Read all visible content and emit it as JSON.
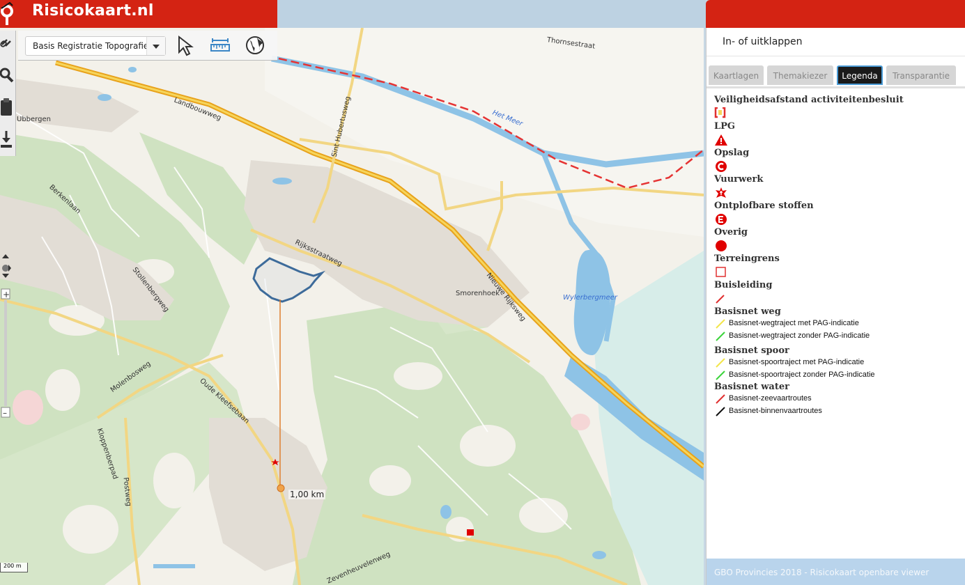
{
  "header": {
    "title": "Risicokaart.nl"
  },
  "toolbar": {
    "layer_select": {
      "value": "Basis Registratie Topografie"
    },
    "tools": [
      {
        "icon": "select-arrow-icon"
      },
      {
        "icon": "measure-ruler-icon"
      },
      {
        "icon": "globe-icon"
      }
    ]
  },
  "left_tools": [
    {
      "icon": "link-icon"
    },
    {
      "icon": "search-icon"
    },
    {
      "icon": "clipboard-icon"
    },
    {
      "icon": "download-icon"
    }
  ],
  "map": {
    "labels": {
      "thornsestraat": "Thornsestraat",
      "landbouwweg": "Landbouwweg",
      "ubbergen": "Ubbergen",
      "sint_hubertusweg": "Sint Hubertusweg",
      "het_meer": "Het Meer",
      "berkenlaan": "Berkenlaan",
      "rijksstraatweg": "Rijksstraatweg",
      "stollenbergweg": "Stollenbergweg",
      "nieuwe_rijksweg": "Nieuwe Rijksweg",
      "smorenhoek": "Smorenhoek",
      "wylerbergmeer": "Wylerbergmeer",
      "molenbosweg": "Molenbosweg",
      "oude_kleefsebaan": "Oude Kleefsebaan",
      "kloppenberpad": "Kloppenberpad",
      "postweg": "Postweg",
      "zevenheuvelenweg": "Zevenheuvelenweg"
    },
    "measure_label": "1,00 km",
    "scale_label": "200 m"
  },
  "panel": {
    "toggle_label": "In- of uitklappen",
    "tabs": [
      {
        "label": "Kaartlagen",
        "active": false
      },
      {
        "label": "Themakiezer",
        "active": false
      },
      {
        "label": "Legenda",
        "active": true
      },
      {
        "label": "Transparantie",
        "active": false
      }
    ],
    "legend": {
      "veiligheidsafstand": "Veiligheidsafstand activiteitenbesluit",
      "lpg": "LPG",
      "opslag": "Opslag",
      "vuurwerk": "Vuurwerk",
      "ontplofbare": "Ontplofbare stoffen",
      "overig": "Overig",
      "terreingrens": "Terreingrens",
      "buisleiding": "Buisleiding",
      "basisnet_weg": "Basisnet weg",
      "weg_met": "Basisnet-wegtraject met PAG-indicatie",
      "weg_zonder": "Basisnet-wegtraject zonder PAG-indicatie",
      "basisnet_spoor": "Basisnet spoor",
      "spoor_met": "Basisnet-spoortraject met PAG-indicatie",
      "spoor_zonder": "Basisnet-spoortraject zonder PAG-indicatie",
      "basisnet_water": "Basisnet water",
      "zeevaart": "Basisnet-zeevaartroutes",
      "binnenvaart": "Basisnet-binnenvaartroutes"
    },
    "footer": "GBO Provincies 2018 - Risicokaart openbare viewer"
  },
  "colors": {
    "brand_red": "#d42313",
    "forest_green": "#cfe2c1",
    "water_blue": "#8ec3e6",
    "motorway_yellow": "#f2c94c"
  }
}
